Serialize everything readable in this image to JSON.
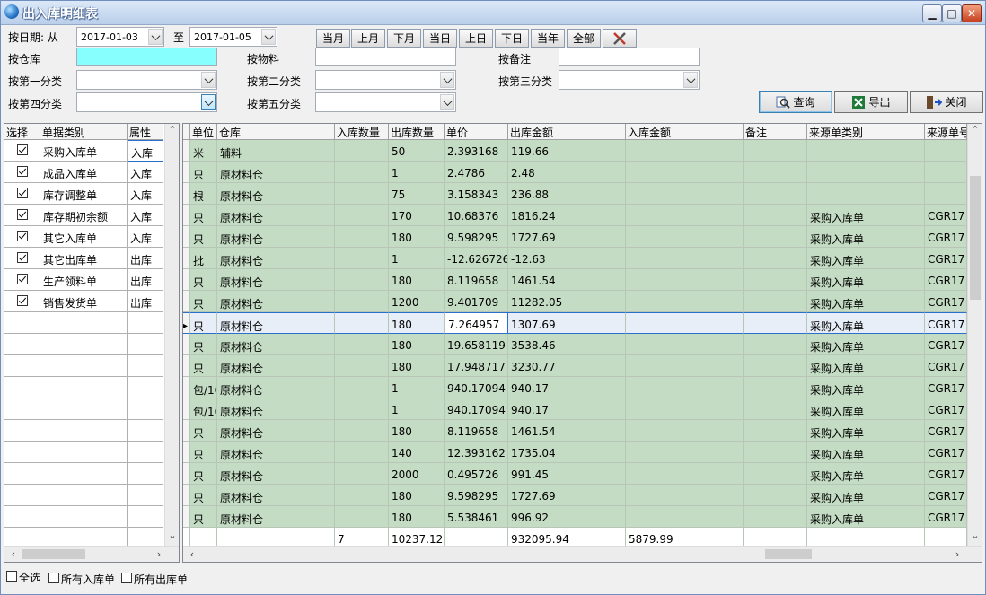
{
  "window": {
    "title": "出入库明细表"
  },
  "filters": {
    "date_label": "按日期: 从",
    "date_from": "2017-01-03",
    "date_to_label": "至",
    "date_to": "2017-01-05",
    "warehouse_label": "按仓库",
    "material_label": "按物料",
    "remark_label": "按备注",
    "cat1_label": "按第一分类",
    "cat2_label": "按第二分类",
    "cat3_label": "按第三分类",
    "cat4_label": "按第四分类",
    "cat5_label": "按第五分类"
  },
  "period_buttons": [
    "当月",
    "上月",
    "下月",
    "当日",
    "上日",
    "下日",
    "当年",
    "全部"
  ],
  "actions": {
    "query": "查询",
    "export": "导出",
    "close": "关闭"
  },
  "left_grid": {
    "headers": [
      "选择",
      "单据类别",
      "属性"
    ],
    "rows": [
      {
        "type": "采购入库单",
        "attr": "入库",
        "checked": true
      },
      {
        "type": "成品入库单",
        "attr": "入库",
        "checked": true
      },
      {
        "type": "库存调整单",
        "attr": "入库",
        "checked": true
      },
      {
        "type": "库存期初余额",
        "attr": "入库",
        "checked": true
      },
      {
        "type": "其它入库单",
        "attr": "入库",
        "checked": true
      },
      {
        "type": "其它出库单",
        "attr": "出库",
        "checked": true
      },
      {
        "type": "生产领料单",
        "attr": "出库",
        "checked": true
      },
      {
        "type": "销售发货单",
        "attr": "出库",
        "checked": true
      }
    ]
  },
  "main_grid": {
    "headers": [
      "单位",
      "仓库",
      "入库数量",
      "出库数量",
      "单价",
      "出库金额",
      "入库金额",
      "备注",
      "来源单类别",
      "来源单号"
    ],
    "rows": [
      [
        "米",
        "辅料",
        "",
        "50",
        "2.393168",
        "119.66",
        "",
        "",
        "",
        ""
      ],
      [
        "只",
        "原材料仓",
        "",
        "1",
        "2.4786",
        "2.48",
        "",
        "",
        "",
        ""
      ],
      [
        "根",
        "原材料仓",
        "",
        "75",
        "3.158343",
        "236.88",
        "",
        "",
        "",
        ""
      ],
      [
        "只",
        "原材料仓",
        "",
        "170",
        "10.68376",
        "1816.24",
        "",
        "",
        "采购入库单",
        "CGR17"
      ],
      [
        "只",
        "原材料仓",
        "",
        "180",
        "9.598295",
        "1727.69",
        "",
        "",
        "采购入库单",
        "CGR17"
      ],
      [
        "批",
        "原材料仓",
        "",
        "1",
        "-12.626726",
        "-12.63",
        "",
        "",
        "采购入库单",
        "CGR17"
      ],
      [
        "只",
        "原材料仓",
        "",
        "180",
        "8.119658",
        "1461.54",
        "",
        "",
        "采购入库单",
        "CGR17"
      ],
      [
        "只",
        "原材料仓",
        "",
        "1200",
        "9.401709",
        "11282.05",
        "",
        "",
        "采购入库单",
        "CGR17"
      ],
      [
        "只",
        "原材料仓",
        "",
        "180",
        "7.264957",
        "1307.69",
        "",
        "",
        "采购入库单",
        "CGR17"
      ],
      [
        "只",
        "原材料仓",
        "",
        "180",
        "19.658119",
        "3538.46",
        "",
        "",
        "采购入库单",
        "CGR17"
      ],
      [
        "只",
        "原材料仓",
        "",
        "180",
        "17.948717",
        "3230.77",
        "",
        "",
        "采购入库单",
        "CGR17"
      ],
      [
        "包/10",
        "原材料仓",
        "",
        "1",
        "940.17094",
        "940.17",
        "",
        "",
        "采购入库单",
        "CGR17"
      ],
      [
        "包/10",
        "原材料仓",
        "",
        "1",
        "940.17094",
        "940.17",
        "",
        "",
        "采购入库单",
        "CGR17"
      ],
      [
        "只",
        "原材料仓",
        "",
        "180",
        "8.119658",
        "1461.54",
        "",
        "",
        "采购入库单",
        "CGR17"
      ],
      [
        "只",
        "原材料仓",
        "",
        "140",
        "12.393162",
        "1735.04",
        "",
        "",
        "采购入库单",
        "CGR17"
      ],
      [
        "只",
        "原材料仓",
        "",
        "2000",
        "0.495726",
        "991.45",
        "",
        "",
        "采购入库单",
        "CGR17"
      ],
      [
        "只",
        "原材料仓",
        "",
        "180",
        "9.598295",
        "1727.69",
        "",
        "",
        "采购入库单",
        "CGR17"
      ],
      [
        "只",
        "原材料仓",
        "",
        "180",
        "5.538461",
        "996.92",
        "",
        "",
        "采购入库单",
        "CGR17"
      ]
    ],
    "selected_row": 8,
    "totals": [
      "",
      "",
      "7",
      "10237.12",
      "",
      "932095.94",
      "5879.99",
      "",
      "",
      ""
    ]
  },
  "bottom": {
    "select_all": "全选",
    "all_in": "所有入库单",
    "all_out": "所有出库单"
  }
}
